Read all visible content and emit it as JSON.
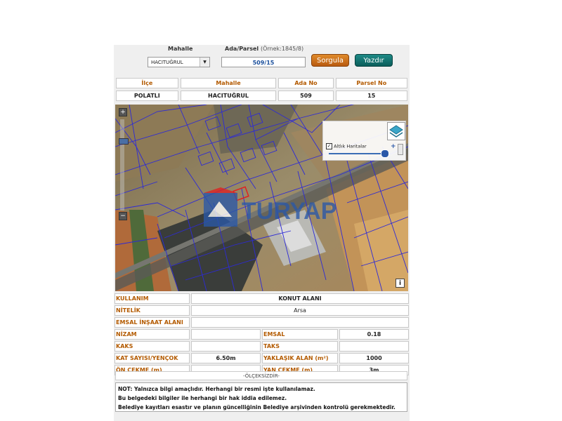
{
  "query": {
    "mahalle_label": "Mahalle",
    "ada_parsel_label": "Ada/Parsel",
    "ada_parsel_hint": "(Örnek:1845/8)",
    "mahalle_value": "HACITUĞRUL",
    "ada_parsel_value": "509/15",
    "query_button": "Sorgula",
    "print_button": "Yazdır"
  },
  "summary": {
    "headers": [
      "İlçe",
      "Mahalle",
      "Ada No",
      "Parsel No"
    ],
    "values": [
      "POLATLI",
      "HACITUĞRUL",
      "509",
      "15"
    ]
  },
  "map": {
    "zoom_in": "+",
    "zoom_out": "−",
    "layer_label": "Altlık Haritalar",
    "layer_checked": true,
    "watermark": "TURYAP",
    "info": "i",
    "colors": {
      "parcel_lines": "#2d2ad6",
      "highlight": "#e02020"
    }
  },
  "details": {
    "kullanim_label": "KULLANIM",
    "kullanim_value": "KONUT ALANI",
    "nitelik_label": "NİTELİK",
    "nitelik_value": "Arsa",
    "emsal_insaat_label": "EMSAL İNŞAAT ALANI",
    "emsal_insaat_value": "",
    "nizam_label": "NİZAM",
    "nizam_value": "",
    "emsal_label": "EMSAL",
    "emsal_value": "0.18",
    "kaks_label": "KAKS",
    "kaks_value": "",
    "taks_label": "TAKS",
    "taks_value": "",
    "kat_label": "KAT SAYISI/YENÇOK",
    "kat_value": "6.50m",
    "alan_label": "YAKLAŞIK ALAN (m²)",
    "alan_value": "1000",
    "on_cekme_label": "ÖN ÇEKME (m)",
    "on_cekme_value": "",
    "yan_cekme_label": "YAN ÇEKME (m)",
    "yan_cekme_value": "3m"
  },
  "scale_text": "-ÖLÇEKSİZDİR-",
  "notes": [
    "NOT: Yalnızca bilgi amaçlıdır. Herhangi bir resmi işte kullanılamaz.",
    "Bu belgedeki bilgiler ile herhangi bir hak iddia edilemez.",
    "Belediye kayıtları esastır ve planın güncelliğinin Belediye arşivinden kontrolü gerekmektedir."
  ]
}
